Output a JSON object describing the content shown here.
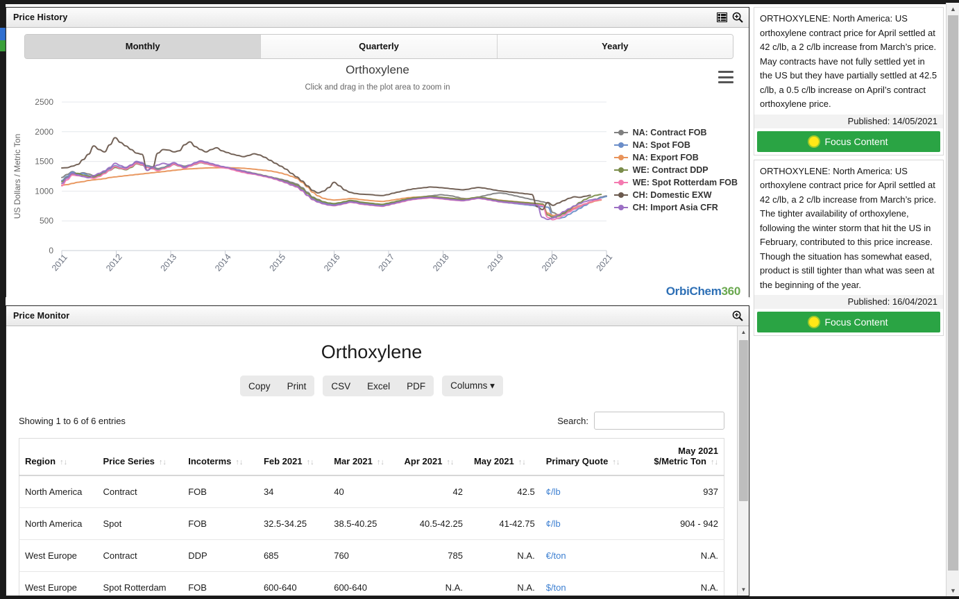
{
  "colors": {
    "na_contract": "#7f7f7f",
    "na_spot": "#6b8ec9",
    "na_export": "#e8935a",
    "we_contract": "#7a8c4a",
    "we_spot": "#f47ab0",
    "ch_domestic": "#6b5a4e",
    "ch_import": "#9b6fc4",
    "focus_green": "#2aa444",
    "quote_link": "#3c7fd1",
    "logo_blue": "#2d6fb5",
    "logo_green": "#6aa84f"
  },
  "price_history": {
    "panel_title": "Price History",
    "icons": {
      "table": "table-icon",
      "zoom": "magnifier-plus-icon"
    },
    "tabs": [
      {
        "label": "Monthly",
        "active": true
      },
      {
        "label": "Quarterly",
        "active": false
      },
      {
        "label": "Yearly",
        "active": false
      }
    ],
    "menu_icon": "hamburger-menu-icon",
    "logo": {
      "part1": "OrbiChem",
      "part2": "360"
    }
  },
  "chart_data": {
    "type": "line",
    "title": "Orthoxylene",
    "subtitle": "Click and drag in the plot area to zoom in",
    "xlabel": "",
    "ylabel": "US Dollars / Metric Ton",
    "ylim": [
      0,
      2500
    ],
    "yticks": [
      0,
      500,
      1000,
      1500,
      2000,
      2500
    ],
    "xticks": [
      "2011",
      "2012",
      "2013",
      "2014",
      "2015",
      "2016",
      "2017",
      "2018",
      "2019",
      "2020",
      "2021"
    ],
    "grid": true,
    "legend_position": "right",
    "series": [
      {
        "name": "NA: Contract FOB",
        "color": "#7f7f7f",
        "values": [
          1230,
          1280,
          1330,
          1290,
          1310,
          1290,
          1260,
          1280,
          1320,
          1380,
          1420,
          1390,
          1400,
          1440,
          1480,
          1460,
          1430,
          1410,
          1380,
          1400,
          1430,
          1460,
          1440,
          1420,
          1440,
          1460,
          1480,
          1470,
          1450,
          1430,
          1410,
          1400,
          1380,
          1360,
          1340,
          1320,
          1300,
          1280,
          1260,
          1240,
          1220,
          1200,
          1180,
          1150,
          1120,
          1060,
          980,
          900,
          860,
          820,
          800,
          790,
          800,
          820,
          840,
          830,
          810,
          800,
          790,
          780,
          770,
          790,
          810,
          830,
          850,
          870,
          890,
          900,
          910,
          920,
          930,
          940,
          930,
          920,
          900,
          880,
          870,
          880,
          900,
          920,
          940,
          960,
          970,
          960,
          940,
          920,
          900,
          880,
          860,
          840,
          820,
          800,
          640,
          600,
          620,
          660,
          700,
          740,
          780,
          820,
          860,
          900,
          920
        ]
      },
      {
        "name": "NA: Spot FOB",
        "color": "#6b8ec9",
        "values": [
          1180,
          1250,
          1320,
          1280,
          1300,
          1260,
          1230,
          1260,
          1310,
          1370,
          1430,
          1400,
          1390,
          1440,
          1500,
          1470,
          1420,
          1390,
          1360,
          1390,
          1420,
          1470,
          1440,
          1400,
          1430,
          1470,
          1500,
          1480,
          1450,
          1420,
          1400,
          1390,
          1370,
          1340,
          1320,
          1300,
          1290,
          1270,
          1250,
          1230,
          1200,
          1170,
          1140,
          1100,
          1070,
          1010,
          930,
          870,
          830,
          800,
          780,
          770,
          790,
          810,
          830,
          820,
          800,
          790,
          780,
          770,
          760,
          780,
          800,
          820,
          840,
          860,
          880,
          890,
          900,
          910,
          900,
          890,
          880,
          870,
          860,
          850,
          860,
          880,
          890,
          880,
          860,
          840,
          820,
          810,
          800,
          790,
          780,
          770,
          760,
          750,
          740,
          730,
          580,
          540,
          560,
          610,
          660,
          710,
          760,
          810,
          850,
          890,
          910
        ]
      },
      {
        "name": "NA: Export FOB",
        "color": "#e8935a",
        "values": [
          1100,
          1110,
          1130,
          1150,
          1160,
          1180,
          1190,
          1200,
          1210,
          1230,
          1240,
          1250,
          1260,
          1270,
          1280,
          1290,
          1300,
          1310,
          1320,
          1330,
          1340,
          1350,
          1360,
          1370,
          1375,
          1380,
          1385,
          1390,
          1392,
          1394,
          1395,
          1396,
          1394,
          1390,
          1385,
          1378,
          1370,
          1360,
          1350,
          1340,
          1325,
          1305,
          1280,
          1250,
          1215,
          1150,
          1070,
          980,
          920,
          880,
          860,
          850,
          855,
          865,
          875,
          870,
          858,
          848,
          840,
          832,
          826,
          836,
          850,
          865,
          880,
          890,
          898,
          902,
          905,
          908,
          903,
          896,
          888,
          880,
          872,
          866,
          872,
          884,
          892,
          888,
          876,
          862,
          848,
          840,
          832,
          824,
          816,
          808,
          800,
          792,
          784,
          630,
          590,
          605,
          640,
          680,
          720,
          755,
          785,
          810,
          835,
          850
        ]
      },
      {
        "name": "WE: Contract DDP",
        "color": "#7a8c4a",
        "values": [
          1160,
          1230,
          1290,
          1300,
          1270,
          1250,
          1240,
          1270,
          1300,
          1350,
          1400,
          1380,
          1360,
          1400,
          1460,
          1440,
          1400,
          1380,
          1350,
          1380,
          1410,
          1450,
          1420,
          1390,
          1420,
          1450,
          1480,
          1460,
          1440,
          1420,
          1400,
          1390,
          1370,
          1350,
          1330,
          1310,
          1300,
          1280,
          1260,
          1240,
          1220,
          1190,
          1160,
          1130,
          1100,
          1040,
          960,
          890,
          850,
          820,
          800,
          790,
          805,
          825,
          845,
          835,
          815,
          805,
          795,
          785,
          778,
          795,
          815,
          835,
          855,
          875,
          890,
          898,
          905,
          912,
          905,
          896,
          888,
          878,
          870,
          862,
          872,
          888,
          900,
          890,
          875,
          858,
          842,
          835,
          828,
          820,
          812,
          805,
          798,
          790,
          782,
          600,
          560,
          580,
          630,
          690,
          750,
          810,
          860,
          900,
          930,
          945
        ]
      },
      {
        "name": "WE: Spot Rotterdam FOB",
        "color": "#f47ab0",
        "values": [
          1090,
          1190,
          1270,
          1260,
          1250,
          1230,
          1215,
          1245,
          1295,
          1355,
          1415,
          1385,
          1370,
          1415,
          1470,
          1445,
          1400,
          1375,
          1345,
          1375,
          1405,
          1455,
          1425,
          1385,
          1420,
          1455,
          1485,
          1465,
          1440,
          1415,
          1395,
          1385,
          1360,
          1335,
          1315,
          1295,
          1285,
          1265,
          1245,
          1225,
          1200,
          1170,
          1140,
          1105,
          1070,
          1005,
          925,
          855,
          815,
          785,
          765,
          755,
          770,
          790,
          812,
          802,
          782,
          772,
          762,
          752,
          745,
          762,
          785,
          805,
          825,
          848,
          862,
          872,
          880,
          888,
          880,
          872,
          862,
          852,
          845,
          838,
          848,
          865,
          878,
          868,
          852,
          835,
          820,
          812,
          805,
          798,
          790,
          782,
          775,
          768,
          760,
          560,
          520,
          545,
          595,
          650,
          700,
          745,
          785,
          820,
          845,
          860
        ]
      },
      {
        "name": "CH: Domestic EXW",
        "color": "#6b5a4e",
        "values": [
          1390,
          1395,
          1420,
          1450,
          1530,
          1620,
          1760,
          1700,
          1660,
          1780,
          1900,
          1820,
          1760,
          1700,
          1640,
          1620,
          1350,
          1400,
          1640,
          1700,
          1690,
          1660,
          1680,
          1780,
          1830,
          1750,
          1700,
          1660,
          1700,
          1730,
          1680,
          1650,
          1620,
          1600,
          1580,
          1600,
          1630,
          1610,
          1570,
          1520,
          1470,
          1420,
          1370,
          1300,
          1240,
          1170,
          1090,
          1010,
          970,
          1000,
          1060,
          1150,
          1090,
          1020,
          980,
          960,
          950,
          945,
          940,
          930,
          925,
          940,
          965,
          985,
          1005,
          1025,
          1040,
          1050,
          1060,
          1070,
          1065,
          1058,
          1050,
          1040,
          1030,
          1022,
          1032,
          1050,
          1062,
          1052,
          1036,
          1020,
          1005,
          995,
          985,
          975,
          965,
          955,
          945,
          740,
          690,
          810,
          760,
          800,
          840,
          880,
          905,
          895,
          915,
          930
        ]
      },
      {
        "name": "CH: Import Asia CFR",
        "color": "#9b6fc4",
        "values": [
          1130,
          1220,
          1300,
          1270,
          1245,
          1225,
          1260,
          1300,
          1340,
          1400,
          1470,
          1430,
          1395,
          1440,
          1500,
          1480,
          1350,
          1400,
          1440,
          1470,
          1450,
          1480,
          1440,
          1400,
          1440,
          1480,
          1510,
          1490,
          1465,
          1440,
          1415,
          1400,
          1380,
          1355,
          1335,
          1310,
          1295,
          1275,
          1255,
          1235,
          1210,
          1180,
          1150,
          1115,
          1080,
          1015,
          930,
          860,
          818,
          788,
          768,
          760,
          775,
          795,
          818,
          808,
          788,
          778,
          768,
          758,
          750,
          768,
          790,
          812,
          835,
          855,
          868,
          878,
          888,
          895,
          888,
          878,
          868,
          858,
          850,
          842,
          852,
          870,
          882,
          872,
          856,
          840,
          825,
          816,
          808,
          800,
          792,
          784,
          776,
          768,
          560,
          525,
          550,
          600,
          655,
          705,
          750,
          790,
          825,
          850,
          868
        ]
      }
    ]
  },
  "price_monitor": {
    "panel_title": "Price Monitor",
    "zoom_icon": "magnifier-plus-icon",
    "title": "Orthoxylene",
    "button_groups": [
      [
        "Copy",
        "Print"
      ],
      [
        "CSV",
        "Excel",
        "PDF"
      ],
      [
        "Columns"
      ]
    ],
    "columns_caret": "▾",
    "showing_text": "Showing 1 to 6 of 6 entries",
    "search_label": "Search:",
    "search_value": "",
    "search_placeholder": "",
    "sort_glyph": "↑↓",
    "columns": [
      {
        "label": "Region",
        "align": "left"
      },
      {
        "label": "Price Series",
        "align": "left"
      },
      {
        "label": "Incoterms",
        "align": "left"
      },
      {
        "label": "Feb 2021",
        "align": "left"
      },
      {
        "label": "Mar 2021",
        "align": "left"
      },
      {
        "label": "Apr 2021",
        "align": "right"
      },
      {
        "label": "May 2021",
        "align": "right"
      },
      {
        "label": "Primary Quote",
        "align": "left"
      },
      {
        "label": "May 2021 $/Metric Ton",
        "label_line1": "May 2021",
        "label_line2": "$/Metric Ton",
        "align": "right"
      }
    ],
    "rows": [
      {
        "region": "North America",
        "series": "Contract",
        "incoterms": "FOB",
        "feb": "34",
        "mar": "40",
        "apr": "42",
        "may": "42.5",
        "quote": "¢/lb",
        "metric_ton": "937"
      },
      {
        "region": "North America",
        "series": "Spot",
        "incoterms": "FOB",
        "feb": "32.5-34.25",
        "mar": "38.5-40.25",
        "apr": "40.5-42.25",
        "may": "41-42.75",
        "quote": "¢/lb",
        "metric_ton": "904 - 942"
      },
      {
        "region": "West Europe",
        "series": "Contract",
        "incoterms": "DDP",
        "feb": "685",
        "mar": "760",
        "apr": "785",
        "may": "N.A.",
        "quote": "€/ton",
        "metric_ton": "N.A."
      },
      {
        "region": "West Europe",
        "series": "Spot Rotterdam",
        "incoterms": "FOB",
        "feb": "600-640",
        "mar": "600-640",
        "apr": "N.A.",
        "may": "N.A.",
        "quote": "$/ton",
        "metric_ton": "N.A."
      }
    ]
  },
  "news": {
    "cards": [
      {
        "text": "ORTHOXYLENE: North America: US orthoxylene contract price for April settled at 42 c/lb, a 2 c/lb increase from March’s price. May contracts have not fully settled yet in the US but they have partially settled at 42.5 c/lb, a 0.5 c/lb increase on April’s contract orthoxylene price.",
        "published": "Published: 14/05/2021",
        "button": "Focus Content"
      },
      {
        "text": "ORTHOXYLENE: North America: US orthoxylene contract price for April settled at 42 c/lb, a 2 c/lb increase from March’s price. The tighter availability of orthoxylene, following the winter storm that hit the US in February, contributed to this price increase. Though the situation has somewhat eased, product is still tighter than what was seen at the beginning of the year.",
        "published": "Published: 16/04/2021",
        "button": "Focus Content"
      }
    ]
  },
  "scrollbars": {
    "up_glyph": "▲",
    "down_glyph": "▼"
  }
}
